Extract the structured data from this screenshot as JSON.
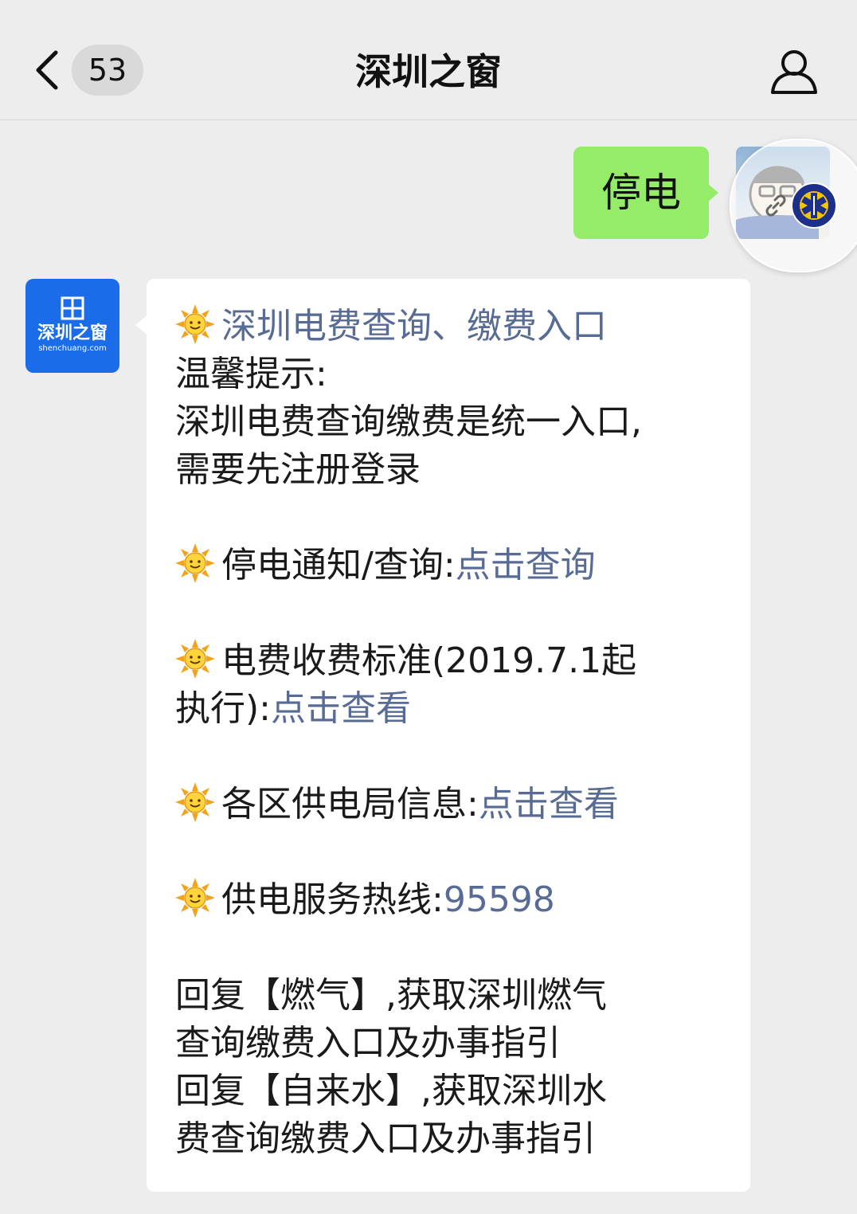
{
  "header": {
    "unread_count": "53",
    "title": "深圳之窗"
  },
  "outgoing": {
    "text": "停电"
  },
  "account": {
    "logo_text": "深圳之窗",
    "logo_sub": "shenchuang.com"
  },
  "message": {
    "section1_title": "深圳电费查询、缴费入口",
    "tip_label": "温馨提示:",
    "tip_line1": "深圳电费查询缴费是统一入口,",
    "tip_line2": "需要先注册登录",
    "outage_label": "停电通知/查询:",
    "outage_link": "点击查询",
    "fee_label_line1": "电费收费标准(2019.7.1起",
    "fee_label_line2": "执行):",
    "fee_link": "点击查看",
    "bureau_label": "各区供电局信息:",
    "bureau_link": "点击查看",
    "hotline_label": "供电服务热线:",
    "hotline_number": "95598",
    "gas_line1": "回复【燃气】,获取深圳燃气",
    "gas_line2": "查询缴费入口及办事指引",
    "water_line1": "回复【自来水】,获取深圳水",
    "water_line2": "费查询缴费入口及办事指引"
  },
  "colors": {
    "background": "#ededed",
    "outgoing_bubble": "#95ec69",
    "incoming_bubble": "#ffffff",
    "link": "#576b95",
    "account_avatar": "#1a6ce8"
  }
}
